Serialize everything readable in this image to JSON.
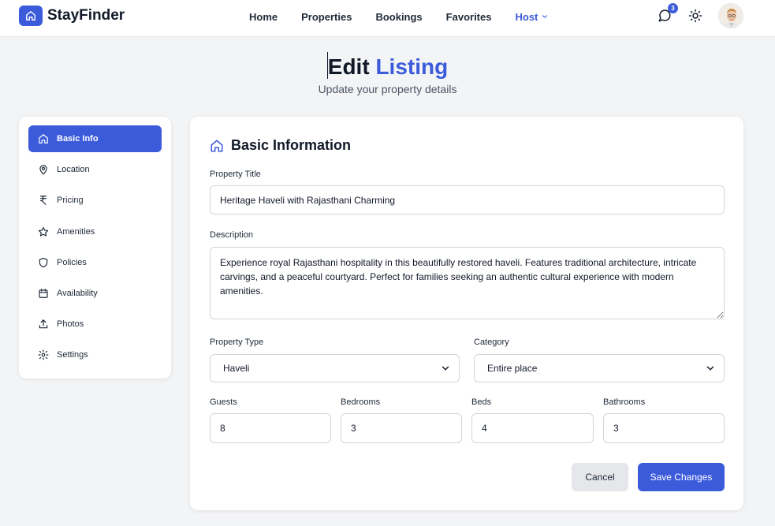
{
  "brand": {
    "name": "StayFinder",
    "icon": "home-icon",
    "accent": "#3b5bdb"
  },
  "nav": {
    "links": [
      "Home",
      "Properties",
      "Bookings",
      "Favorites"
    ],
    "host_label": "Host",
    "chat_badge": "3",
    "icons": [
      "chat-icon",
      "sun-icon",
      "avatar"
    ]
  },
  "header": {
    "title_part1": "Edit",
    "title_part2": "Listing",
    "subtitle": "Update your property details"
  },
  "sidebar": {
    "items": [
      {
        "label": "Basic Info",
        "icon": "home-icon",
        "active": true
      },
      {
        "label": "Location",
        "icon": "map-pin-icon"
      },
      {
        "label": "Pricing",
        "icon": "rupee-icon"
      },
      {
        "label": "Amenities",
        "icon": "star-icon"
      },
      {
        "label": "Policies",
        "icon": "shield-icon"
      },
      {
        "label": "Availability",
        "icon": "calendar-icon"
      },
      {
        "label": "Photos",
        "icon": "upload-icon"
      },
      {
        "label": "Settings",
        "icon": "gear-icon"
      }
    ]
  },
  "form": {
    "heading": "Basic Information",
    "title_label": "Property Title",
    "title_value": "Heritage Haveli with Rajasthani Charming",
    "description_label": "Description",
    "description_value": "Experience royal Rajasthani hospitality in this beautifully restored haveli. Features traditional architecture, intricate carvings, and a peaceful courtyard. Perfect for families seeking an authentic cultural experience with modern amenities.",
    "type_label": "Property Type",
    "type_value": "Haveli",
    "category_label": "Category",
    "category_value": "Entire place",
    "guests_label": "Guests",
    "guests_value": "8",
    "bedrooms_label": "Bedrooms",
    "bedrooms_value": "3",
    "beds_label": "Beds",
    "beds_value": "4",
    "bathrooms_label": "Bathrooms",
    "bathrooms_value": "3",
    "cancel_label": "Cancel",
    "save_label": "Save Changes"
  }
}
